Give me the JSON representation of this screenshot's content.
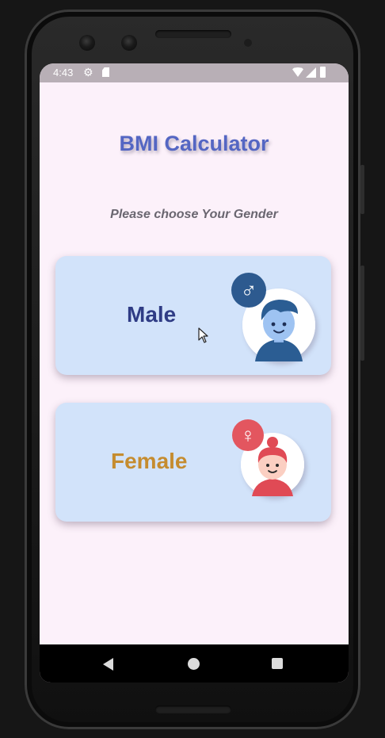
{
  "status_bar": {
    "time": "4:43",
    "icons": [
      "settings-icon",
      "sd-card-icon",
      "wifi-icon",
      "signal-icon",
      "battery-icon"
    ]
  },
  "app": {
    "title": "BMI Calculator",
    "subtitle": "Please choose Your Gender",
    "title_color": "#5466c3"
  },
  "gender_options": [
    {
      "label": "Male",
      "badge_symbol": "♂",
      "label_color": "#2f3c85",
      "card_color": "#d2e3fa",
      "badge_color": "#2d5a8f"
    },
    {
      "label": "Female",
      "badge_symbol": "♀",
      "label_color": "#c58c2f",
      "card_color": "#d2e3fa",
      "badge_color": "#e3565f"
    }
  ],
  "navigation": {
    "buttons": [
      "back-icon",
      "home-icon",
      "recents-icon"
    ]
  },
  "colors": {
    "background": "#fcf1fa",
    "status_bar": "#b8afb6"
  }
}
